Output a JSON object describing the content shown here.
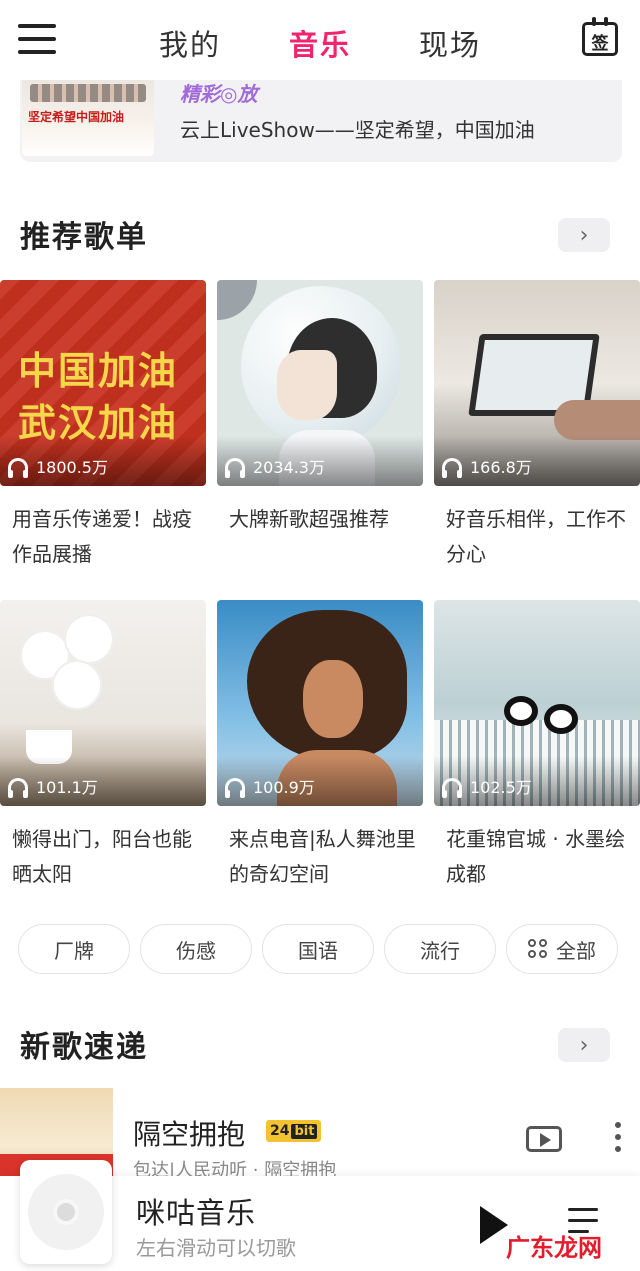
{
  "topnav": {
    "tabs": [
      {
        "label": "我的",
        "active": false
      },
      {
        "label": "音乐",
        "active": true
      },
      {
        "label": "现场",
        "active": false
      }
    ],
    "sign_label": "签",
    "accent_color": "#f0256e"
  },
  "banner": {
    "thumb_text": "坚定希望中国加油",
    "tag": "精彩◎放",
    "text": "云上LiveShow——坚定希望，中国加油"
  },
  "recommend": {
    "title": "推荐歌单",
    "more": "›",
    "playlists": [
      {
        "title": "用音乐传递爱！战疫作品展播",
        "plays": "1800.5万",
        "cover_text": [
          "中国加油",
          "武汉加油"
        ]
      },
      {
        "title": "大牌新歌超强推荐",
        "plays": "2034.3万"
      },
      {
        "title": "好音乐相伴，工作不分心",
        "plays": "166.8万"
      },
      {
        "title": "懒得出门，阳台也能晒太阳",
        "plays": "101.1万"
      },
      {
        "title": "来点电音|私人舞池里的奇幻空间",
        "plays": "100.9万"
      },
      {
        "title": "花重锦官城 · 水墨绘成都",
        "plays": "102.5万"
      }
    ]
  },
  "chips": [
    "厂牌",
    "伤感",
    "国语",
    "流行",
    "全部"
  ],
  "new_songs": {
    "title": "新歌速递",
    "more": "›",
    "song": {
      "title": "隔空拥抱",
      "badge_a": "24",
      "badge_b": "bit",
      "subtitle": "包达|人民动听 · 隔空拥抱"
    }
  },
  "player": {
    "title": "咪咕音乐",
    "subtitle": "左右滑动可以切歌"
  },
  "watermark": "广东龙网"
}
